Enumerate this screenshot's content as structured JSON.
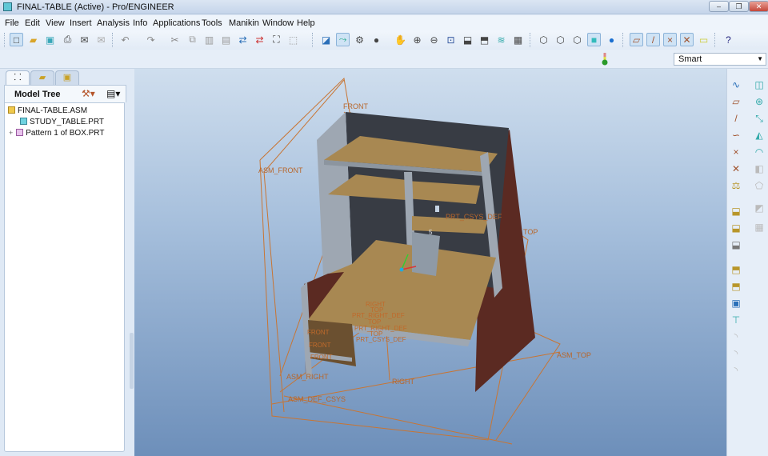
{
  "window": {
    "title": "FINAL-TABLE (Active) - Pro/ENGINEER",
    "minimize": "–",
    "restore": "❐",
    "close": "✕"
  },
  "menu": [
    "File",
    "Edit",
    "View",
    "Insert",
    "Analysis",
    "Info",
    "Applications",
    "Tools",
    "Manikin",
    "Window",
    "Help"
  ],
  "toolbar": {
    "selection_filter": "Smart"
  },
  "left_panel": {
    "header": "Model Tree",
    "tree": [
      {
        "label": "FINAL-TABLE.ASM"
      },
      {
        "label": "STUDY_TABLE.PRT"
      },
      {
        "label": "Pattern 1 of BOX.PRT"
      }
    ],
    "expand": "+"
  },
  "viewport": {
    "datum_labels": {
      "front": "FRONT",
      "asm_front": "ASM_FRONT",
      "top": "TOP",
      "asm_top": "ASM_TOP",
      "asm_right": "ASM_RIGHT",
      "right": "RIGHT",
      "asm_def_csys": "ASM_DEF_CSYS",
      "prt_csys_def": "PRT_CSYS_DEF",
      "box_right": "RIGHT",
      "box_top": "TOP",
      "box_prt_right": "PRT_RIGHT_DEF",
      "box_top2": "TOP",
      "box_prt_right2": "PRT_RIGHT_DEF",
      "box_top3": "TOP",
      "box_prt_csys": "PRT_CSYS_DEF",
      "box_front1": "FRONT",
      "box_front2": "FRONT",
      "box_front3": "FRONT",
      "marker": "5"
    }
  },
  "colors": {
    "datum": "#c87533",
    "side_panel": "#5b2a22",
    "back_panel": "#383c44",
    "wood": "#a88852",
    "frame": "#9ea7b2"
  }
}
